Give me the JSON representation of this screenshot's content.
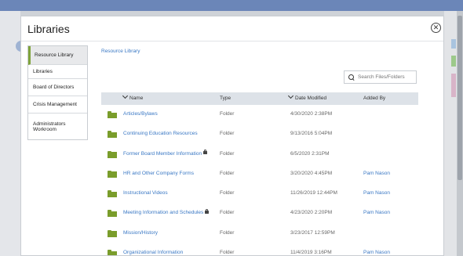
{
  "modal": {
    "title": "Libraries",
    "close_symbol": "✕"
  },
  "sidebar": {
    "items": [
      {
        "label": "Resource Library",
        "selected": true
      },
      {
        "label": "Libraries",
        "selected": false
      },
      {
        "label": "Board of Directors",
        "selected": false
      },
      {
        "label": "Crisis Management",
        "selected": false
      },
      {
        "label": "Administrators Workroom",
        "selected": false
      }
    ]
  },
  "breadcrumb": "Resource Library",
  "search": {
    "placeholder": "Search Files/Folders",
    "value": ""
  },
  "table": {
    "headers": {
      "name": "Name",
      "type": "Type",
      "date": "Date Modified",
      "added_by": "Added By"
    },
    "rows": [
      {
        "name": "Articles/Bylaws",
        "type": "Folder",
        "date": "4/30/2020 2:38PM",
        "added_by": "",
        "locked": false
      },
      {
        "name": "Continuing Education Resources",
        "type": "Folder",
        "date": "9/13/2016 5:04PM",
        "added_by": "",
        "locked": false
      },
      {
        "name": "Former Board Member Information",
        "type": "Folder",
        "date": "6/5/2020 2:31PM",
        "added_by": "",
        "locked": true
      },
      {
        "name": "HR and Other Company Forms",
        "type": "Folder",
        "date": "3/20/2020 4:45PM",
        "added_by": "Pam Nason",
        "locked": false
      },
      {
        "name": "Instructional Videos",
        "type": "Folder",
        "date": "11/26/2019 12:44PM",
        "added_by": "Pam Nason",
        "locked": false
      },
      {
        "name": "Meeting Information and Schedules",
        "type": "Folder",
        "date": "4/23/2020 2:20PM",
        "added_by": "Pam Nason",
        "locked": true
      },
      {
        "name": "Mission/History",
        "type": "Folder",
        "date": "3/23/2017 12:59PM",
        "added_by": "",
        "locked": false
      },
      {
        "name": "Organizational Information",
        "type": "Folder",
        "date": "11/4/2019 3:16PM",
        "added_by": "Pam Nason",
        "locked": false
      }
    ]
  },
  "colors": {
    "accent": "#7fa33b",
    "link": "#3a78c4",
    "folder": "#7a9d2b",
    "header_bg": "#dde2e8"
  },
  "icons": {
    "folder": "folder-icon",
    "lock": "lock-icon",
    "search": "search-icon",
    "close": "close-icon",
    "sort": "chevron-down-icon"
  }
}
